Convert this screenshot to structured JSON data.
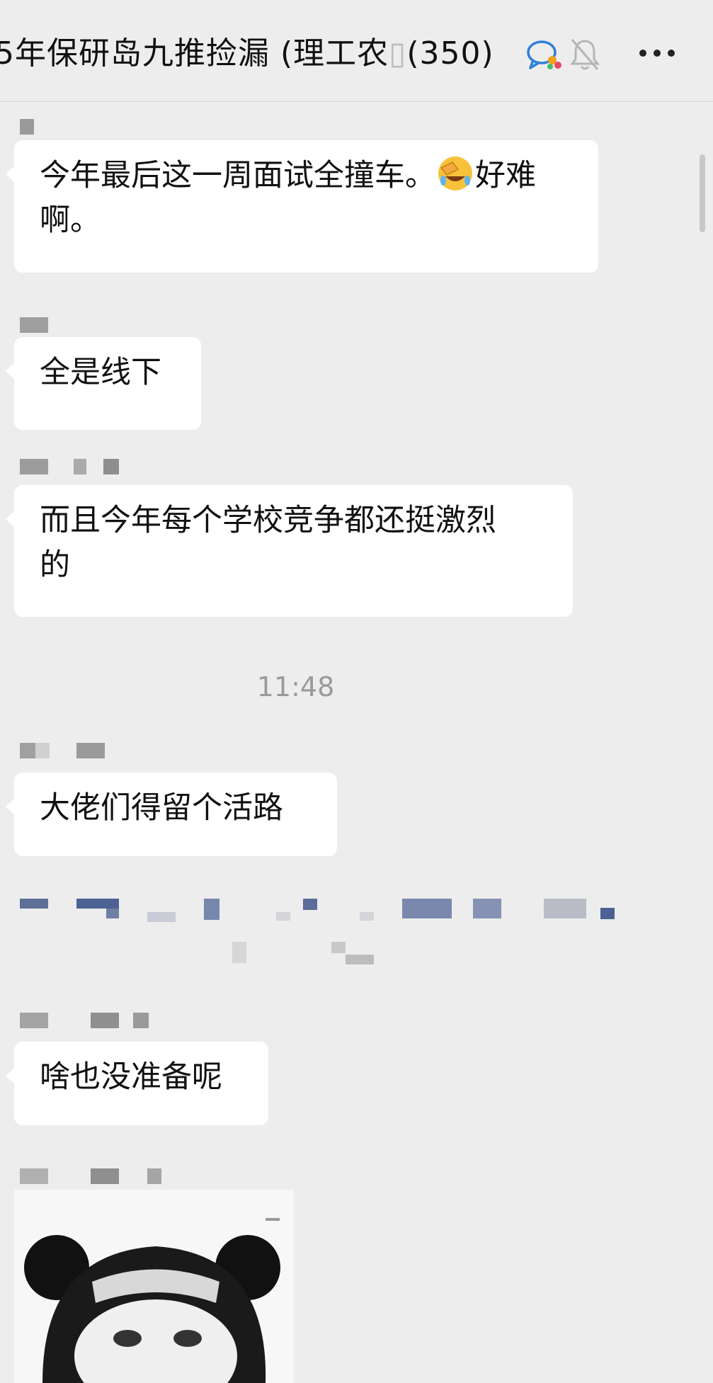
{
  "header": {
    "title": "5年保研岛九推捡漏 (理工农",
    "member_count": "(350)",
    "icons": [
      "chat-bubble-icon",
      "mute-bell-icon",
      "more-icon"
    ]
  },
  "messages": [
    {
      "text_line1": "今年最后这一周面试全撞车。",
      "text_line1_tail": "好难",
      "text_line2": "啊。",
      "emoji": "facepalm-laugh-emoji"
    },
    {
      "text": "全是线下"
    },
    {
      "text_line1": "而且今年每个学校竞争都还挺激烈",
      "text_line2": "的"
    },
    {
      "text": "大佬们得留个活路"
    },
    {
      "text": "啥也没准备呢"
    }
  ],
  "timestamp": "11:48",
  "colors": {
    "background": "#ededed",
    "bubble": "#ffffff",
    "timestamp": "#9a9a9a",
    "accent_blue": "#2f7fd8"
  }
}
